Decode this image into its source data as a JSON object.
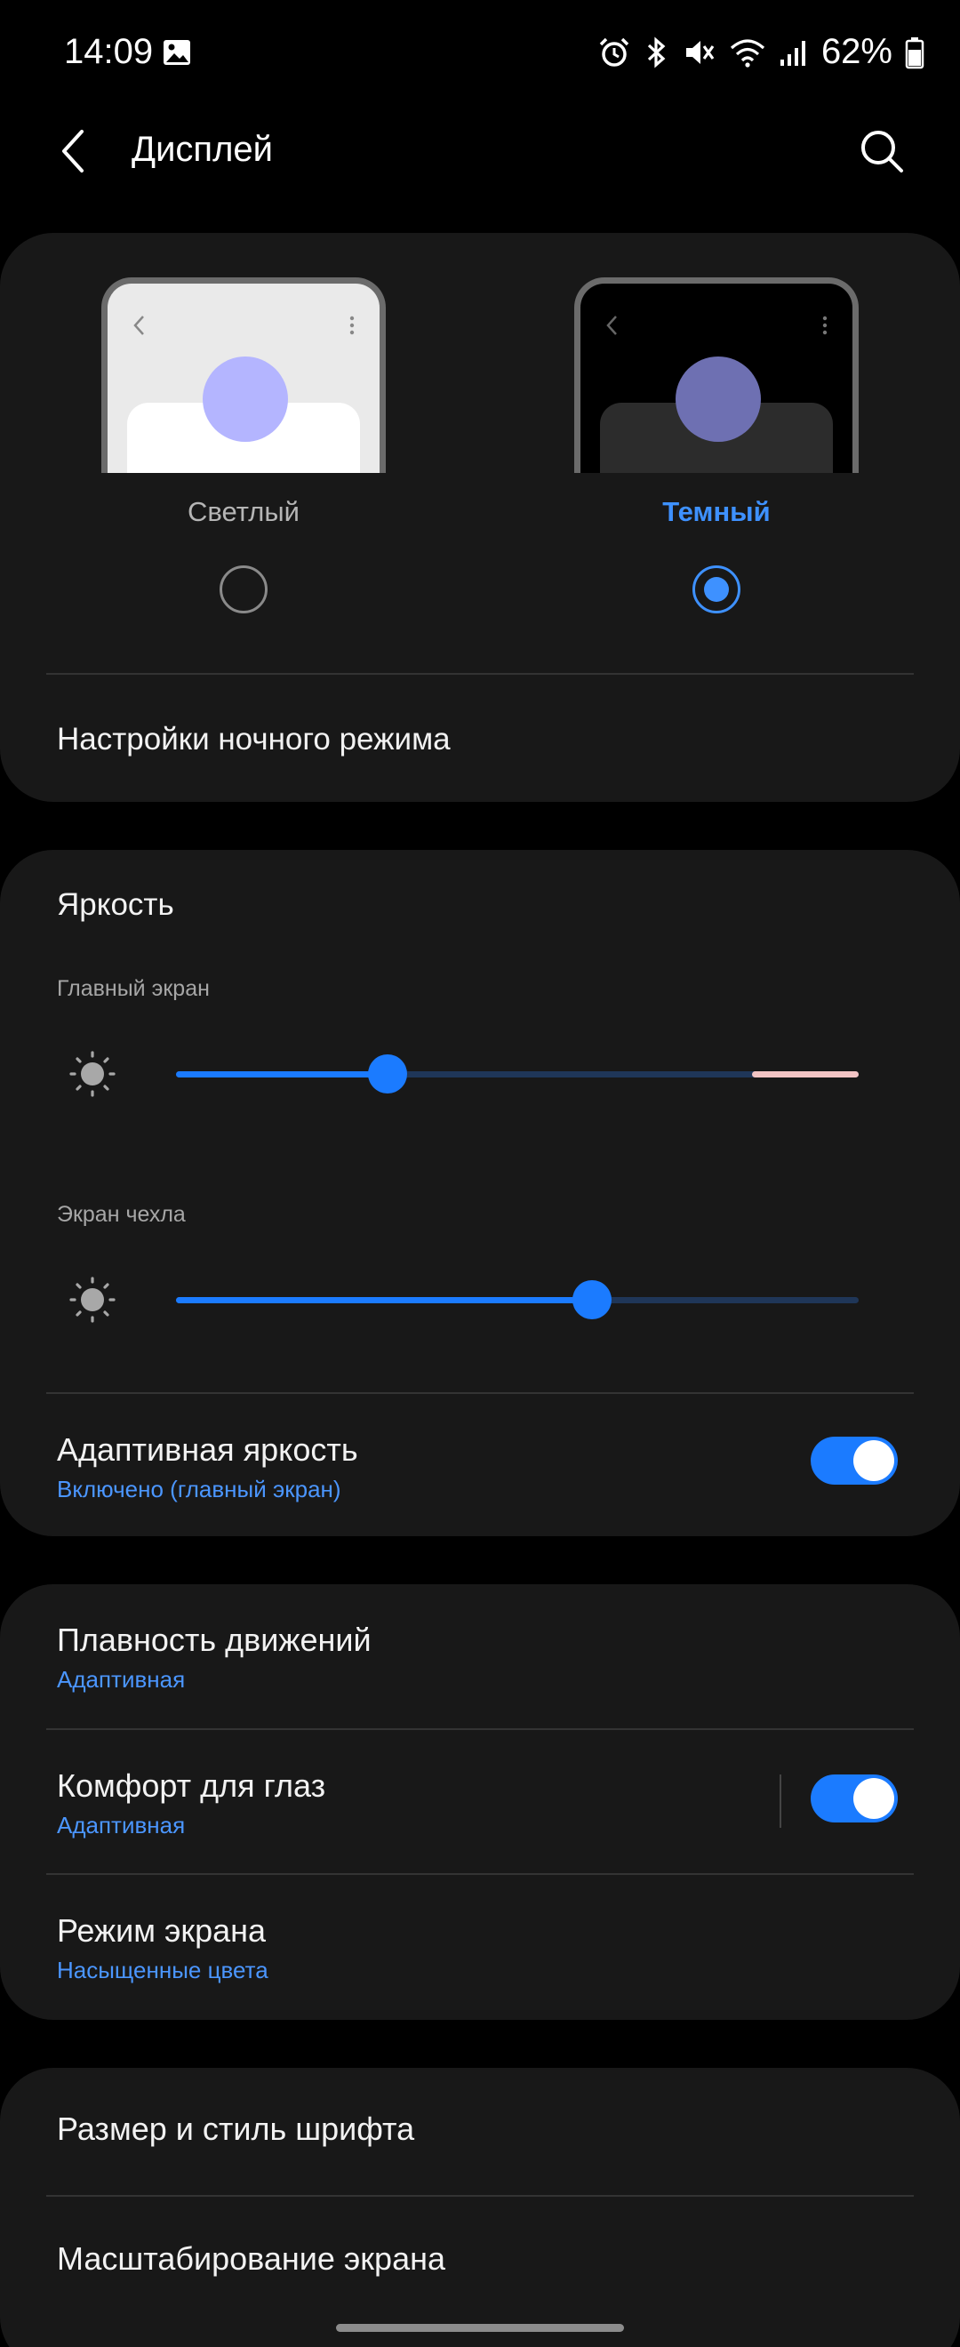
{
  "status_bar": {
    "time": "14:09",
    "battery": "62%"
  },
  "header": {
    "title": "Дисплей"
  },
  "theme": {
    "light_label": "Светлый",
    "dark_label": "Темный",
    "selected": "dark",
    "night_settings": "Настройки ночного режима"
  },
  "brightness": {
    "title": "Яркость",
    "main_screen_label": "Главный экран",
    "main_screen_level": 0.31,
    "cover_screen_label": "Экран чехла",
    "cover_screen_level": 0.61,
    "adaptive_title": "Адаптивная яркость",
    "adaptive_status": "Включено (главный экран)",
    "adaptive_on": true
  },
  "display": {
    "motion_title": "Плавность движений",
    "motion_value": "Адаптивная",
    "eye_title": "Комфорт для глаз",
    "eye_value": "Адаптивная",
    "eye_on": true,
    "mode_title": "Режим экрана",
    "mode_value": "Насыщенные цвета"
  },
  "font": {
    "font_title": "Размер и стиль шрифта",
    "zoom_title": "Масштабирование экрана"
  },
  "colors": {
    "accent": "#1b7bff",
    "accent_text": "#3e91ff",
    "card": "#181818",
    "background": "#000000"
  }
}
